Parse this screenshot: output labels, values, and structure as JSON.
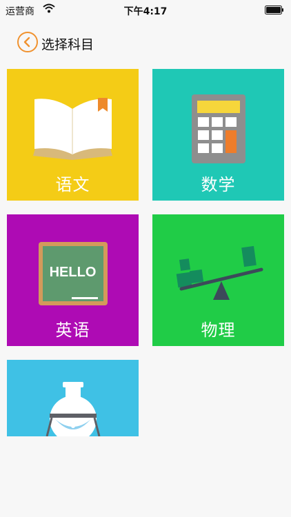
{
  "status_bar": {
    "carrier": "运营商",
    "time": "下午4:17"
  },
  "nav": {
    "title": "选择科目"
  },
  "subjects": [
    {
      "label": "语文",
      "icon": "book-icon",
      "color": "#f4cc16"
    },
    {
      "label": "数学",
      "icon": "calculator-icon",
      "color": "#1fc8b5"
    },
    {
      "label": "英语",
      "icon": "chalkboard-icon",
      "color": "#ae0bb4"
    },
    {
      "label": "物理",
      "icon": "seesaw-icon",
      "color": "#20cc47"
    },
    {
      "label": "",
      "icon": "flask-icon",
      "color": "#3fc1e5"
    }
  ],
  "chalkboard_text": "HELLO",
  "colors": {
    "accent": "#f0922f",
    "background": "#f7f7f7"
  }
}
